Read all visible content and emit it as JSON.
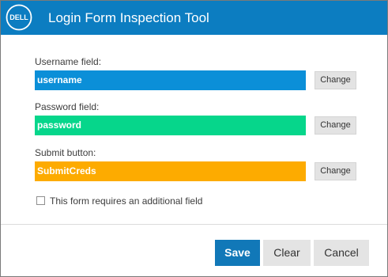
{
  "window": {
    "title": "Login Form Inspection Tool",
    "brand": "DELL",
    "titlebar_color": "#0c7dc1",
    "logo_icon": "dell-logo-icon"
  },
  "fields": [
    {
      "label": "Username field:",
      "value": "username",
      "color": "#0b8fd8",
      "change_label": "Change"
    },
    {
      "label": "Password field:",
      "value": "password",
      "color": "#06d68b",
      "change_label": "Change"
    },
    {
      "label": "Submit button:",
      "value": "SubmitCreds",
      "color": "#fdab00",
      "change_label": "Change"
    }
  ],
  "options": {
    "additional_field_label": "This form requires an additional field",
    "additional_field_checked": false
  },
  "footer": {
    "save_label": "Save",
    "clear_label": "Clear",
    "cancel_label": "Cancel",
    "save_color": "#1178b8"
  }
}
